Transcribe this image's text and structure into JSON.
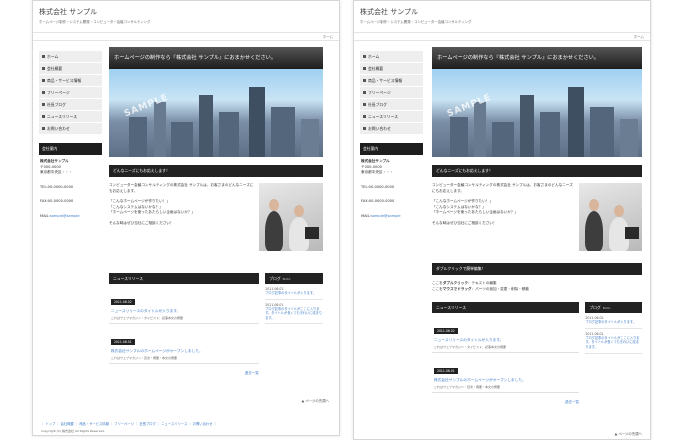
{
  "site": {
    "title": "株式会社 サンプル",
    "tagline": "ホームページ制作・システム開発・コンピューター会議コンサルティング",
    "breadcrumb_home": "ホーム"
  },
  "nav": [
    "ホーム",
    "会社概要",
    "商品・サービス情報",
    "フリーページ",
    "社長ブログ",
    "ニュースリリース",
    "お問い合わせ"
  ],
  "sidebar": {
    "heading": "会社案内",
    "company_name": "株式会社サンプル",
    "postal": "〒000-0000",
    "address": "東京都中央区・・・",
    "tel": "TEL:00-0000-0000",
    "fax": "FAX:00-0000-0000",
    "mail_label": "MAIL:",
    "mail_link": "sample@sample"
  },
  "hero": {
    "text": "ホームページの制作なら『株式会社 サンプル』におまかせください。",
    "watermark": "SAMPLE"
  },
  "intro": {
    "heading": "どんなニーズにもお応えします！",
    "p1": "コンピューター会議コンサルティングの株式会社 サンプルは、お客さまのどんなニーズにもお応えします。",
    "p2a": "「こんなホームページが作りたい！」",
    "p2b": "「こんなシステムはないかな？」",
    "p2c": "「ホームページを使ったあたらしい企画はないか？」",
    "p3": "そんな時はぜひ当社にご相談ください！"
  },
  "dblclick": {
    "heading": "ダブルクリックで簡単編集！",
    "line1_pre": "ここを",
    "line1_bold": "ダブルクリック",
    "line1_post": "：テキストの編集",
    "line2_pre": "ここを",
    "line2_bold": "マウスでドラッグ",
    "line2_post": "：パーツの追加・変更・削除・移動"
  },
  "news": {
    "heading": "ニュースリリース",
    "items": [
      {
        "date": "2011.06.02",
        "title": "ニュースリリースのタイトルが入ります。",
        "meta": "これはウェブマガジン・タイピスト：記事本文の概要"
      },
      {
        "date": "2011.06.01",
        "title": "株式会社サンプルのホームページがオープンしました。",
        "meta": "これはウェブマガジン・目次・概要・本文の概要"
      }
    ],
    "more": "過去一覧"
  },
  "blog": {
    "heading": "ブログ",
    "sub": "BLOG",
    "items": [
      {
        "date": "2011.06.02",
        "title": "ブログ記事のタイトルが入ります。"
      },
      {
        "date": "2011.06.01",
        "title": "ブログ記事のタイトルがここに入ります。タイトルが長くてもきれいに収まります。"
      }
    ]
  },
  "footer": {
    "scroll_top": "▲ ページの先頭へ",
    "links": "｜ トップ ｜ 会社概要 ｜ 商品・サービス情報 ｜ フリーページ ｜ 社長ブログ ｜ ニュースリリース ｜ お問い合わせ ｜",
    "copyright": "Copyright (C) 株式会社 All Rights Reserved."
  }
}
